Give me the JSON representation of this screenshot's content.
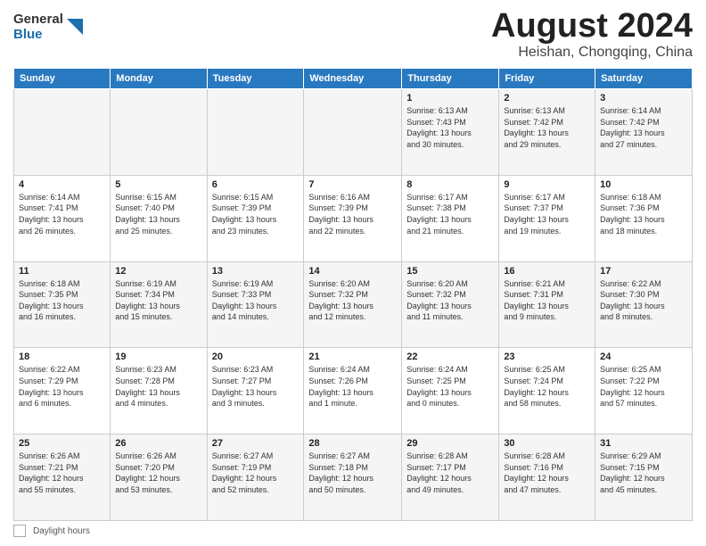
{
  "header": {
    "logo_general": "General",
    "logo_blue": "Blue",
    "month_title": "August 2024",
    "location": "Heishan, Chongqing, China"
  },
  "footer": {
    "daylight_label": "Daylight hours"
  },
  "weekdays": [
    "Sunday",
    "Monday",
    "Tuesday",
    "Wednesday",
    "Thursday",
    "Friday",
    "Saturday"
  ],
  "weeks": [
    [
      {
        "day": "",
        "info": ""
      },
      {
        "day": "",
        "info": ""
      },
      {
        "day": "",
        "info": ""
      },
      {
        "day": "",
        "info": ""
      },
      {
        "day": "1",
        "info": "Sunrise: 6:13 AM\nSunset: 7:43 PM\nDaylight: 13 hours\nand 30 minutes."
      },
      {
        "day": "2",
        "info": "Sunrise: 6:13 AM\nSunset: 7:42 PM\nDaylight: 13 hours\nand 29 minutes."
      },
      {
        "day": "3",
        "info": "Sunrise: 6:14 AM\nSunset: 7:42 PM\nDaylight: 13 hours\nand 27 minutes."
      }
    ],
    [
      {
        "day": "4",
        "info": "Sunrise: 6:14 AM\nSunset: 7:41 PM\nDaylight: 13 hours\nand 26 minutes."
      },
      {
        "day": "5",
        "info": "Sunrise: 6:15 AM\nSunset: 7:40 PM\nDaylight: 13 hours\nand 25 minutes."
      },
      {
        "day": "6",
        "info": "Sunrise: 6:15 AM\nSunset: 7:39 PM\nDaylight: 13 hours\nand 23 minutes."
      },
      {
        "day": "7",
        "info": "Sunrise: 6:16 AM\nSunset: 7:39 PM\nDaylight: 13 hours\nand 22 minutes."
      },
      {
        "day": "8",
        "info": "Sunrise: 6:17 AM\nSunset: 7:38 PM\nDaylight: 13 hours\nand 21 minutes."
      },
      {
        "day": "9",
        "info": "Sunrise: 6:17 AM\nSunset: 7:37 PM\nDaylight: 13 hours\nand 19 minutes."
      },
      {
        "day": "10",
        "info": "Sunrise: 6:18 AM\nSunset: 7:36 PM\nDaylight: 13 hours\nand 18 minutes."
      }
    ],
    [
      {
        "day": "11",
        "info": "Sunrise: 6:18 AM\nSunset: 7:35 PM\nDaylight: 13 hours\nand 16 minutes."
      },
      {
        "day": "12",
        "info": "Sunrise: 6:19 AM\nSunset: 7:34 PM\nDaylight: 13 hours\nand 15 minutes."
      },
      {
        "day": "13",
        "info": "Sunrise: 6:19 AM\nSunset: 7:33 PM\nDaylight: 13 hours\nand 14 minutes."
      },
      {
        "day": "14",
        "info": "Sunrise: 6:20 AM\nSunset: 7:32 PM\nDaylight: 13 hours\nand 12 minutes."
      },
      {
        "day": "15",
        "info": "Sunrise: 6:20 AM\nSunset: 7:32 PM\nDaylight: 13 hours\nand 11 minutes."
      },
      {
        "day": "16",
        "info": "Sunrise: 6:21 AM\nSunset: 7:31 PM\nDaylight: 13 hours\nand 9 minutes."
      },
      {
        "day": "17",
        "info": "Sunrise: 6:22 AM\nSunset: 7:30 PM\nDaylight: 13 hours\nand 8 minutes."
      }
    ],
    [
      {
        "day": "18",
        "info": "Sunrise: 6:22 AM\nSunset: 7:29 PM\nDaylight: 13 hours\nand 6 minutes."
      },
      {
        "day": "19",
        "info": "Sunrise: 6:23 AM\nSunset: 7:28 PM\nDaylight: 13 hours\nand 4 minutes."
      },
      {
        "day": "20",
        "info": "Sunrise: 6:23 AM\nSunset: 7:27 PM\nDaylight: 13 hours\nand 3 minutes."
      },
      {
        "day": "21",
        "info": "Sunrise: 6:24 AM\nSunset: 7:26 PM\nDaylight: 13 hours\nand 1 minute."
      },
      {
        "day": "22",
        "info": "Sunrise: 6:24 AM\nSunset: 7:25 PM\nDaylight: 13 hours\nand 0 minutes."
      },
      {
        "day": "23",
        "info": "Sunrise: 6:25 AM\nSunset: 7:24 PM\nDaylight: 12 hours\nand 58 minutes."
      },
      {
        "day": "24",
        "info": "Sunrise: 6:25 AM\nSunset: 7:22 PM\nDaylight: 12 hours\nand 57 minutes."
      }
    ],
    [
      {
        "day": "25",
        "info": "Sunrise: 6:26 AM\nSunset: 7:21 PM\nDaylight: 12 hours\nand 55 minutes."
      },
      {
        "day": "26",
        "info": "Sunrise: 6:26 AM\nSunset: 7:20 PM\nDaylight: 12 hours\nand 53 minutes."
      },
      {
        "day": "27",
        "info": "Sunrise: 6:27 AM\nSunset: 7:19 PM\nDaylight: 12 hours\nand 52 minutes."
      },
      {
        "day": "28",
        "info": "Sunrise: 6:27 AM\nSunset: 7:18 PM\nDaylight: 12 hours\nand 50 minutes."
      },
      {
        "day": "29",
        "info": "Sunrise: 6:28 AM\nSunset: 7:17 PM\nDaylight: 12 hours\nand 49 minutes."
      },
      {
        "day": "30",
        "info": "Sunrise: 6:28 AM\nSunset: 7:16 PM\nDaylight: 12 hours\nand 47 minutes."
      },
      {
        "day": "31",
        "info": "Sunrise: 6:29 AM\nSunset: 7:15 PM\nDaylight: 12 hours\nand 45 minutes."
      }
    ]
  ]
}
